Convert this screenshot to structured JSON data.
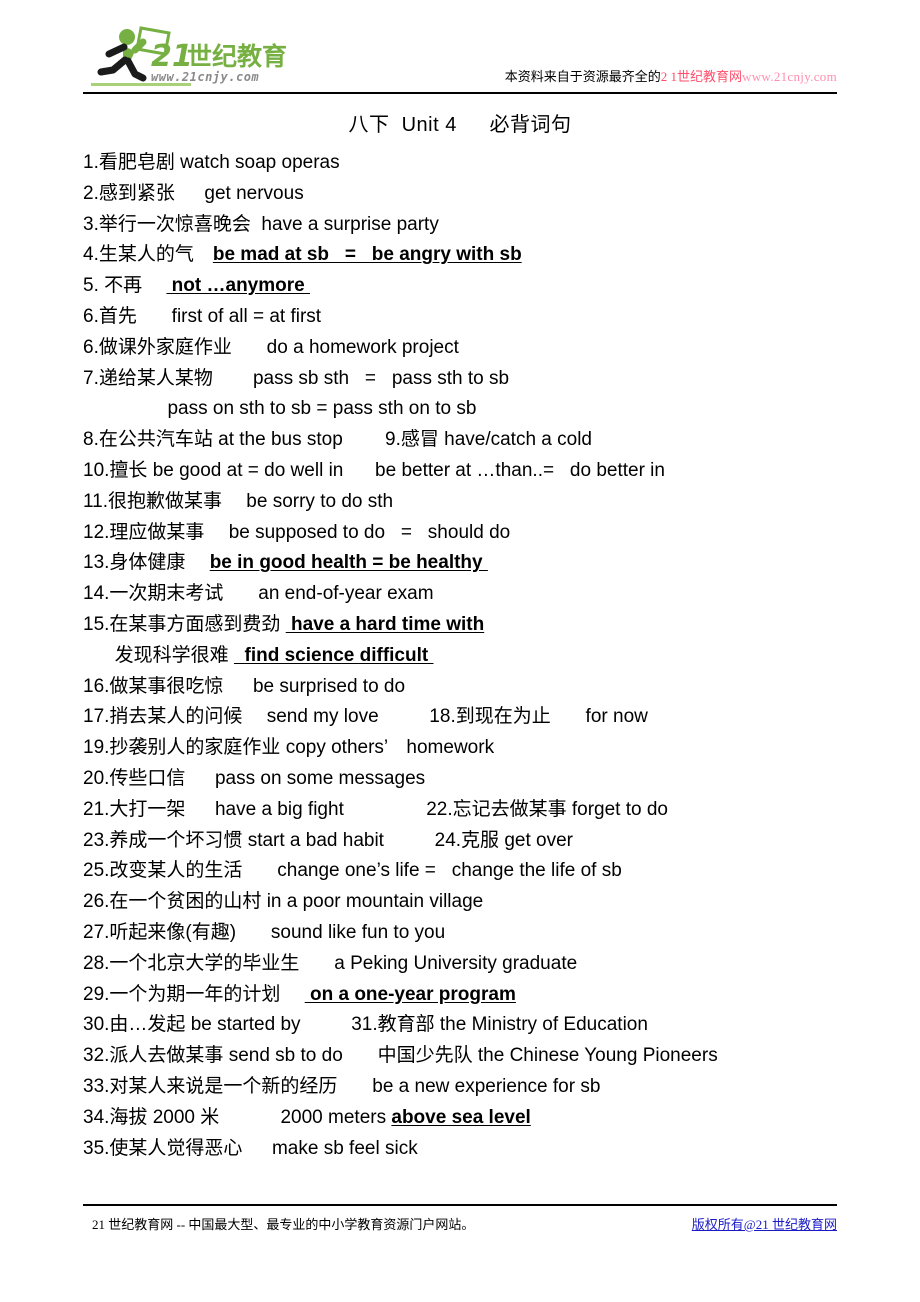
{
  "header": {
    "logo": {
      "brand_cn": "21世纪教育",
      "brand_url": "www.21cnjy.com",
      "icon": "running-man-with-flag-logo",
      "green": "#76b043",
      "gray": "#8a8a8a"
    },
    "notice_prefix": "本资料来自于资源最齐全的",
    "notice_highlight": "2 1世纪教育网",
    "notice_url": "www.21cnjy.com"
  },
  "title": "八下  Unit 4　  必背词句",
  "lines": [
    {
      "text": "1.看肥皂剧 watch soap operas",
      "bold_part": ""
    },
    {
      "text": "2.感到紧张　  get nervous",
      "bold_part": ""
    },
    {
      "text": "3.举行一次惊喜晚会  have a surprise party",
      "bold_part": ""
    },
    {
      "text": "4.生某人的气　",
      "bold_part": "be mad at sb   =   be angry with sb"
    },
    {
      "text": "5. 不再　 ",
      "bold_part": " not …anymore "
    },
    {
      "text": "6.首先　   first of all = at first",
      "bold_part": ""
    },
    {
      "text": "6.做课外家庭作业　   do a homework project",
      "bold_part": ""
    },
    {
      "text": "7.递给某人某物　    pass sb sth   =   pass sth to sb",
      "bold_part": ""
    },
    {
      "text": "                pass on sth to sb = pass sth on to sb",
      "bold_part": ""
    },
    {
      "text": "8.在公共汽车站 at the bus stop        9.感冒 have/catch a cold",
      "bold_part": ""
    },
    {
      "text": "10.擅长 be good at = do well in      be better at …than..=   do better in",
      "bold_part": ""
    },
    {
      "text": "11.很抱歉做某事　 be sorry to do sth",
      "bold_part": ""
    },
    {
      "text": "12.理应做某事　 be supposed to do   =   should do",
      "bold_part": ""
    },
    {
      "text": "13.身体健康　 ",
      "bold_part": "be in good health = be healthy "
    },
    {
      "text": "14.一次期末考试　   an end-of-year exam",
      "bold_part": ""
    },
    {
      "text": "15.在某事方面感到费劲 ",
      "bold_part": " have a hard time with"
    },
    {
      "text": "      发现科学很难 ",
      "bold_part": "  find science difficult "
    },
    {
      "text": "16.做某事很吃惊　  be surprised to do",
      "bold_part": ""
    },
    {
      "text": "17.捎去某人的问候　 send my love　      18.到现在为止　   for now",
      "bold_part": ""
    },
    {
      "text": "19.抄袭别人的家庭作业 copy others’　homework",
      "bold_part": ""
    },
    {
      "text": "20.传些口信　  pass on some messages",
      "bold_part": ""
    },
    {
      "text": "21.大打一架　  have a big fight　            22.忘记去做某事 forget to do",
      "bold_part": ""
    },
    {
      "text": "23.养成一个坏习惯 start a bad habit　      24.克服 get over",
      "bold_part": ""
    },
    {
      "text": "25.改变某人的生活　   change one’s life =   change the life of sb",
      "bold_part": ""
    },
    {
      "text": "26.在一个贫困的山村 in a poor mountain village",
      "bold_part": ""
    },
    {
      "text": "27.听起来像(有趣)　   sound like fun to you",
      "bold_part": ""
    },
    {
      "text": "28.一个北京大学的毕业生　   a Peking University graduate",
      "bold_part": ""
    },
    {
      "text": "29.一个为期一年的计划　 ",
      "bold_part": " on a one-year program"
    },
    {
      "text": "30.由…发起 be started by　      31.教育部 the Ministry of Education",
      "bold_part": ""
    },
    {
      "text": "32.派人去做某事 send sb to do　   中国少先队 the Chinese Young Pioneers",
      "bold_part": ""
    },
    {
      "text": "33.对某人来说是一个新的经历　   be a new experience for sb",
      "bold_part": ""
    },
    {
      "text": "34.海拔 2000 米　        2000 meters ",
      "bold_part": "above sea level"
    },
    {
      "text": "35.使某人觉得恶心　  make sb feel sick",
      "bold_part": ""
    }
  ],
  "footer": {
    "left_text": "21 世纪教育网  --  中国最大型、最专业的中小学教育资源门户网站。",
    "link_text": "版权所有@21 世纪教育网",
    "link_color": "#1a1ac8"
  }
}
